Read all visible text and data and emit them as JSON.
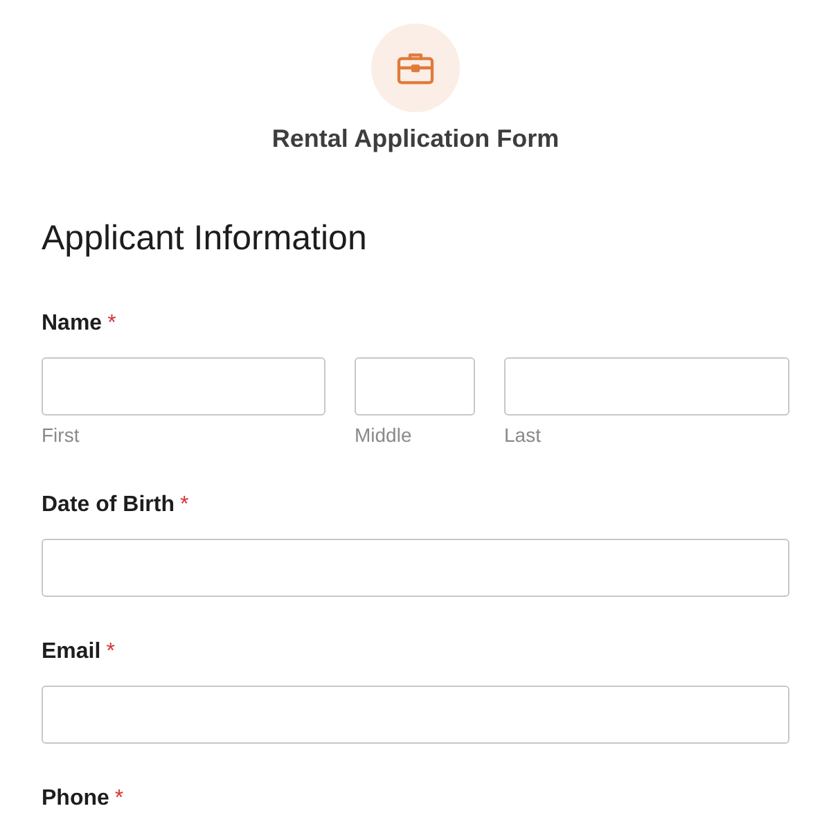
{
  "header": {
    "title": "Rental Application Form"
  },
  "section": {
    "title": "Applicant Information"
  },
  "fields": [
    {
      "kind": "name",
      "label": "Name",
      "required_mark": "*",
      "parts": [
        {
          "sublabel": "First"
        },
        {
          "sublabel": "Middle"
        },
        {
          "sublabel": "Last"
        }
      ]
    },
    {
      "kind": "text",
      "label": "Date of Birth",
      "required_mark": "*"
    },
    {
      "kind": "text",
      "label": "Email",
      "required_mark": "*"
    },
    {
      "kind": "label",
      "label": "Phone",
      "required_mark": "*"
    }
  ]
}
